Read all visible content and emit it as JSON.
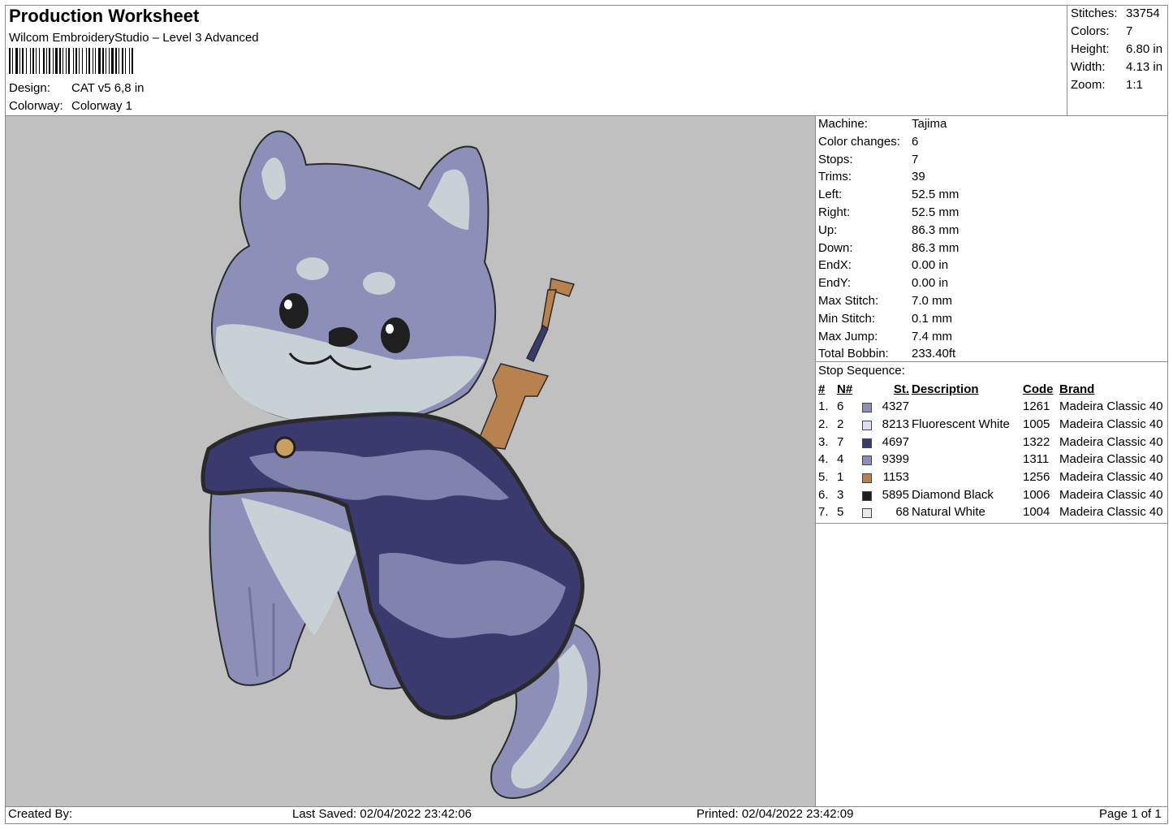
{
  "header": {
    "title": "Production Worksheet",
    "software": "Wilcom EmbroideryStudio – Level 3 Advanced",
    "design_label": "Design:",
    "design_value": "CAT v5 6,8 in",
    "colorway_label": "Colorway:",
    "colorway_value": "Colorway 1"
  },
  "summary": [
    {
      "label": "Stitches:",
      "value": "33754"
    },
    {
      "label": "Colors:",
      "value": "7"
    },
    {
      "label": "Height:",
      "value": "6.80 in"
    },
    {
      "label": "Width:",
      "value": "4.13 in"
    },
    {
      "label": "Zoom:",
      "value": "1:1"
    }
  ],
  "machine_info": [
    {
      "label": "Machine:",
      "value": "Tajima"
    },
    {
      "label": "Color changes:",
      "value": "6"
    },
    {
      "label": "Stops:",
      "value": "7"
    },
    {
      "label": "Trims:",
      "value": "39"
    },
    {
      "label": "Left:",
      "value": "52.5 mm"
    },
    {
      "label": "Right:",
      "value": "52.5 mm"
    },
    {
      "label": "Up:",
      "value": "86.3 mm"
    },
    {
      "label": "Down:",
      "value": "86.3 mm"
    },
    {
      "label": "EndX:",
      "value": "0.00 in"
    },
    {
      "label": "EndY:",
      "value": "0.00 in"
    },
    {
      "label": "Max Stitch:",
      "value": "7.0 mm"
    },
    {
      "label": "Min Stitch:",
      "value": "0.1 mm"
    },
    {
      "label": "Max Jump:",
      "value": "7.4 mm"
    },
    {
      "label": "Total Bobbin:",
      "value": "233.40ft"
    }
  ],
  "stop_sequence": {
    "label": "Stop Sequence:",
    "columns": [
      "#",
      "N#",
      "St.",
      "Description",
      "Code",
      "Brand"
    ],
    "rows": [
      {
        "num": "1.",
        "n": "6",
        "color": "#8c90b8",
        "st": "4327",
        "desc": "",
        "code": "1261",
        "brand": "Madeira Classic 40"
      },
      {
        "num": "2.",
        "n": "2",
        "color": "#dde0f4",
        "st": "8213",
        "desc": "Fluorescent White",
        "code": "1005",
        "brand": "Madeira Classic 40"
      },
      {
        "num": "3.",
        "n": "7",
        "color": "#3a3a6e",
        "st": "4697",
        "desc": "",
        "code": "1322",
        "brand": "Madeira Classic 40"
      },
      {
        "num": "4.",
        "n": "4",
        "color": "#8d8dbf",
        "st": "9399",
        "desc": "",
        "code": "1311",
        "brand": "Madeira Classic 40"
      },
      {
        "num": "5.",
        "n": "1",
        "color": "#b8824f",
        "st": "1153",
        "desc": "",
        "code": "1256",
        "brand": "Madeira Classic 40"
      },
      {
        "num": "6.",
        "n": "3",
        "color": "#1e1e1e",
        "st": "5895",
        "desc": "Diamond Black",
        "code": "1006",
        "brand": "Madeira Classic 40"
      },
      {
        "num": "7.",
        "n": "5",
        "color": "#e6e8ea",
        "st": "68",
        "desc": "Natural White",
        "code": "1004",
        "brand": "Madeira Classic 40"
      }
    ]
  },
  "footer": {
    "created_by": "Created By:",
    "last_saved": "Last Saved: 02/04/2022 23:42:06",
    "printed": "Printed: 02/04/2022 23:42:09",
    "page": "Page 1 of 1"
  }
}
